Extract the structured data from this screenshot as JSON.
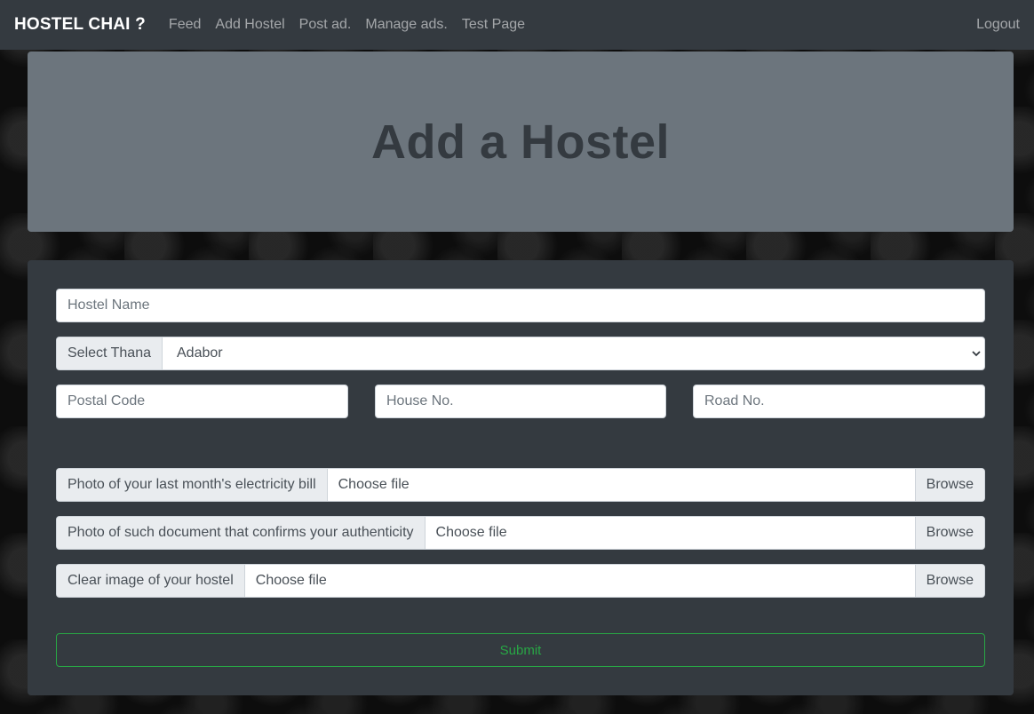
{
  "navbar": {
    "brand": "HOSTEL CHAI ?",
    "links": [
      "Feed",
      "Add Hostel",
      "Post ad.",
      "Manage ads.",
      "Test Page"
    ],
    "logout": "Logout"
  },
  "jumbotron": {
    "title": "Add a Hostel"
  },
  "form": {
    "hostel_name_placeholder": "Hostel Name",
    "thana_label": "Select Thana",
    "thana_value": "Adabor",
    "postal_code_placeholder": "Postal Code",
    "house_no_placeholder": "House No.",
    "road_no_placeholder": "Road No.",
    "files": [
      {
        "label": "Photo of your last month's electricity bill",
        "value": "Choose file",
        "browse": "Browse"
      },
      {
        "label": "Photo of such document that confirms your authenticity",
        "value": "Choose file",
        "browse": "Browse"
      },
      {
        "label": "Clear image of your hostel",
        "value": "Choose file",
        "browse": "Browse"
      }
    ],
    "submit": "Submit"
  },
  "colors": {
    "navbar": "#343a40",
    "jumbotron": "#6c757d",
    "card": "#343a40",
    "submit": "#28a745"
  }
}
